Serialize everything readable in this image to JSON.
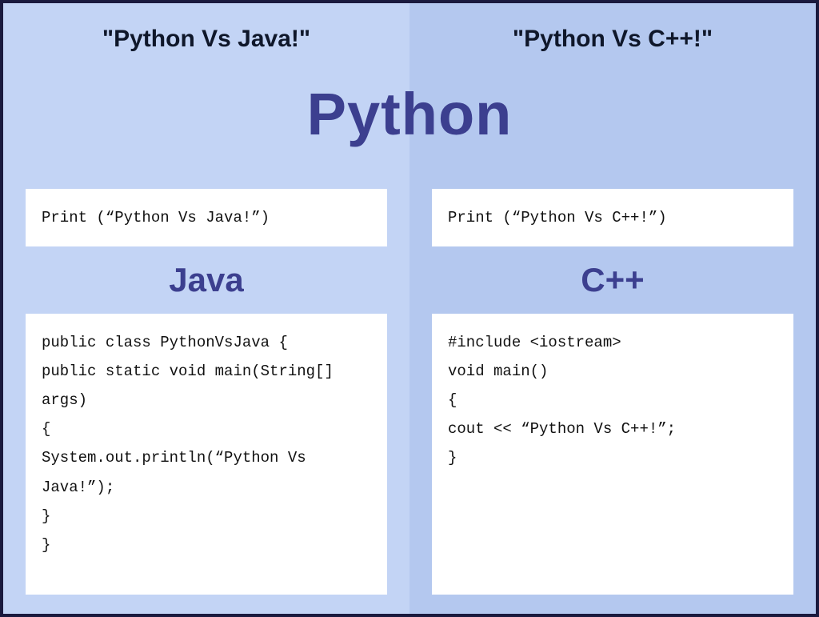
{
  "center": {
    "python_label": "Python"
  },
  "left": {
    "title": "\"Python Vs Java!\"",
    "python_code": "Print (“Python Vs Java!”)",
    "lang_label": "Java",
    "lang_code": "public class PythonVsJava {\npublic static void main(String[] args)\n{\nSystem.out.println(“Python Vs Java!”);\n}\n}"
  },
  "right": {
    "title": "\"Python Vs C++!\"",
    "python_code": "Print (“Python Vs C++!”)",
    "lang_label": "C++",
    "lang_code": "#include <iostream>\nvoid main()\n{\ncout << “Python Vs C++!”;\n}"
  }
}
